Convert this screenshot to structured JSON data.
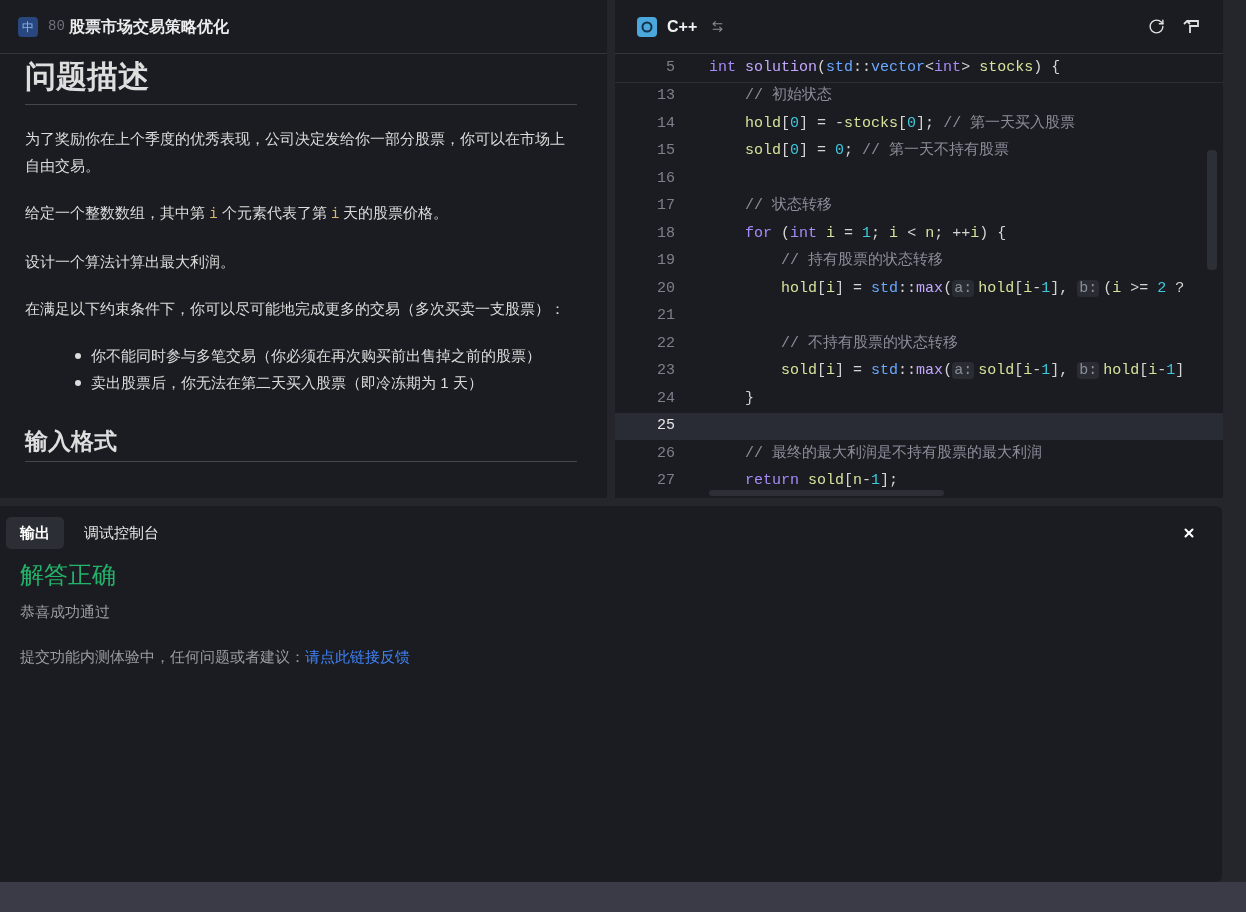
{
  "problem": {
    "language_badge": "中",
    "number": "80",
    "title": "股票市场交易策略优化"
  },
  "description": {
    "heading": "问题描述",
    "paragraphs": [
      [
        {
          "kind": "text",
          "text": "为了奖励你在上个季度的优秀表现，公司决定发给你一部分股票，你可以在市场上自由交易。"
        }
      ],
      [
        {
          "kind": "text",
          "text": "给定一个整数数组，其中第 "
        },
        {
          "kind": "code",
          "text": "i"
        },
        {
          "kind": "text",
          "text": " 个元素代表了第 "
        },
        {
          "kind": "code",
          "text": "i"
        },
        {
          "kind": "text",
          "text": " 天的股票价格。"
        }
      ],
      [
        {
          "kind": "text",
          "text": "设计一个算法计算出最大利润。"
        }
      ],
      [
        {
          "kind": "text",
          "text": "在满足以下约束条件下，你可以尽可能地完成更多的交易（多次买卖一支股票）："
        }
      ]
    ],
    "bullets": [
      "你不能同时参与多笔交易（你必须在再次购买前出售掉之前的股票）",
      "卖出股票后，你无法在第二天买入股票（即冷冻期为 1 天）"
    ],
    "next_heading": "输入格式"
  },
  "editor": {
    "language": "C++",
    "sticky_line": {
      "number": "5",
      "current": false,
      "tokens": [
        {
          "kind": "kw",
          "text": "int"
        },
        {
          "kind": "fn",
          "text": " solution"
        },
        {
          "kind": "punc",
          "text": "("
        },
        {
          "kind": "ns",
          "text": "std"
        },
        {
          "kind": "punc",
          "text": "::"
        },
        {
          "kind": "ns",
          "text": "vector"
        },
        {
          "kind": "punc",
          "text": "<"
        },
        {
          "kind": "kw",
          "text": "int"
        },
        {
          "kind": "punc",
          "text": "> "
        },
        {
          "kind": "var",
          "text": "stocks"
        },
        {
          "kind": "punc",
          "text": ") {"
        }
      ]
    },
    "lines": [
      {
        "number": "13",
        "current": false,
        "tokens": [
          {
            "kind": "com",
            "text": "    // 初始状态"
          }
        ]
      },
      {
        "number": "14",
        "current": false,
        "tokens": [
          {
            "kind": "var",
            "text": "    hold"
          },
          {
            "kind": "punc",
            "text": "["
          },
          {
            "kind": "num",
            "text": "0"
          },
          {
            "kind": "punc",
            "text": "] = -"
          },
          {
            "kind": "var",
            "text": "stocks"
          },
          {
            "kind": "punc",
            "text": "["
          },
          {
            "kind": "num",
            "text": "0"
          },
          {
            "kind": "punc",
            "text": "]; "
          },
          {
            "kind": "com",
            "text": "// 第一天买入股票"
          }
        ]
      },
      {
        "number": "15",
        "current": false,
        "tokens": [
          {
            "kind": "var",
            "text": "    sold"
          },
          {
            "kind": "punc",
            "text": "["
          },
          {
            "kind": "num",
            "text": "0"
          },
          {
            "kind": "punc",
            "text": "] = "
          },
          {
            "kind": "num",
            "text": "0"
          },
          {
            "kind": "punc",
            "text": "; "
          },
          {
            "kind": "com",
            "text": "// 第一天不持有股票"
          }
        ]
      },
      {
        "number": "16",
        "current": false
      },
      {
        "number": "17",
        "current": false,
        "tokens": [
          {
            "kind": "com",
            "text": "    // 状态转移"
          }
        ]
      },
      {
        "number": "18",
        "current": false,
        "tokens": [
          {
            "kind": "kw",
            "text": "    for"
          },
          {
            "kind": "punc",
            "text": " ("
          },
          {
            "kind": "kw",
            "text": "int"
          },
          {
            "kind": "var",
            "text": " i"
          },
          {
            "kind": "punc",
            "text": " = "
          },
          {
            "kind": "num",
            "text": "1"
          },
          {
            "kind": "punc",
            "text": "; "
          },
          {
            "kind": "var",
            "text": "i"
          },
          {
            "kind": "punc",
            "text": " < "
          },
          {
            "kind": "var",
            "text": "n"
          },
          {
            "kind": "punc",
            "text": "; ++"
          },
          {
            "kind": "var",
            "text": "i"
          },
          {
            "kind": "punc",
            "text": ") {"
          }
        ]
      },
      {
        "number": "19",
        "current": false,
        "tokens": [
          {
            "kind": "com",
            "text": "        // 持有股票的状态转移"
          }
        ]
      },
      {
        "number": "20",
        "current": false,
        "tokens": [
          {
            "kind": "var",
            "text": "        hold"
          },
          {
            "kind": "punc",
            "text": "["
          },
          {
            "kind": "var",
            "text": "i"
          },
          {
            "kind": "punc",
            "text": "] = "
          },
          {
            "kind": "ns",
            "text": "std"
          },
          {
            "kind": "punc",
            "text": "::"
          },
          {
            "kind": "fn",
            "text": "max"
          },
          {
            "kind": "punc",
            "text": "("
          },
          {
            "kind": "hint",
            "text": "a:"
          },
          {
            "kind": "var",
            "text": "hold"
          },
          {
            "kind": "punc",
            "text": "["
          },
          {
            "kind": "var",
            "text": "i"
          },
          {
            "kind": "punc",
            "text": "-"
          },
          {
            "kind": "num",
            "text": "1"
          },
          {
            "kind": "punc",
            "text": "], "
          },
          {
            "kind": "hint",
            "text": "b:"
          },
          {
            "kind": "punc",
            "text": "("
          },
          {
            "kind": "var",
            "text": "i"
          },
          {
            "kind": "punc",
            "text": " >= "
          },
          {
            "kind": "num",
            "text": "2"
          },
          {
            "kind": "punc",
            "text": " ?"
          }
        ]
      },
      {
        "number": "21",
        "current": false
      },
      {
        "number": "22",
        "current": false,
        "tokens": [
          {
            "kind": "com",
            "text": "        // 不持有股票的状态转移"
          }
        ]
      },
      {
        "number": "23",
        "current": false,
        "tokens": [
          {
            "kind": "var",
            "text": "        sold"
          },
          {
            "kind": "punc",
            "text": "["
          },
          {
            "kind": "var",
            "text": "i"
          },
          {
            "kind": "punc",
            "text": "] = "
          },
          {
            "kind": "ns",
            "text": "std"
          },
          {
            "kind": "punc",
            "text": "::"
          },
          {
            "kind": "fn",
            "text": "max"
          },
          {
            "kind": "punc",
            "text": "("
          },
          {
            "kind": "hint",
            "text": "a:"
          },
          {
            "kind": "var",
            "text": "sold"
          },
          {
            "kind": "punc",
            "text": "["
          },
          {
            "kind": "var",
            "text": "i"
          },
          {
            "kind": "punc",
            "text": "-"
          },
          {
            "kind": "num",
            "text": "1"
          },
          {
            "kind": "punc",
            "text": "], "
          },
          {
            "kind": "hint",
            "text": "b:"
          },
          {
            "kind": "var",
            "text": "hold"
          },
          {
            "kind": "punc",
            "text": "["
          },
          {
            "kind": "var",
            "text": "i"
          },
          {
            "kind": "punc",
            "text": "-"
          },
          {
            "kind": "num",
            "text": "1"
          },
          {
            "kind": "punc",
            "text": "]"
          }
        ]
      },
      {
        "number": "24",
        "current": false,
        "tokens": [
          {
            "kind": "punc",
            "text": "    }"
          }
        ]
      },
      {
        "number": "25",
        "current": true
      },
      {
        "number": "26",
        "current": false,
        "tokens": [
          {
            "kind": "com",
            "text": "    // 最终的最大利润是不持有股票的最大利润"
          }
        ]
      },
      {
        "number": "27",
        "current": false,
        "tokens": [
          {
            "kind": "kw",
            "text": "    return"
          },
          {
            "kind": "var",
            "text": " sold"
          },
          {
            "kind": "punc",
            "text": "["
          },
          {
            "kind": "var",
            "text": "n"
          },
          {
            "kind": "punc",
            "text": "-"
          },
          {
            "kind": "num",
            "text": "1"
          },
          {
            "kind": "punc",
            "text": "];"
          }
        ]
      }
    ]
  },
  "output": {
    "tabs": [
      {
        "label": "输出",
        "selected": true
      },
      {
        "label": "调试控制台",
        "selected": false
      }
    ],
    "result": "解答正确",
    "message": "恭喜成功通过",
    "feedback": "提交功能内测体验中，任何问题或者建议：",
    "feedback_link": "请点此链接反馈"
  }
}
